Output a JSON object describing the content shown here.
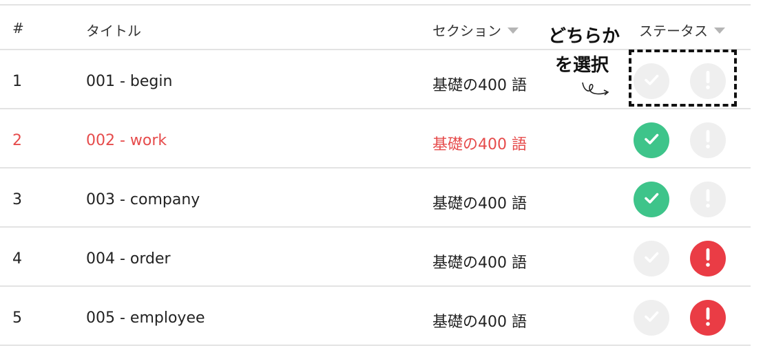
{
  "table": {
    "headers": {
      "num": "#",
      "title": "タイトル",
      "section": "セクション",
      "status": "ステータス"
    },
    "rows": [
      {
        "num": "1",
        "title": "001 - begin",
        "section": "基礎の400 語",
        "ok": false,
        "ng": false,
        "selected": false
      },
      {
        "num": "2",
        "title": "002 - work",
        "section": "基礎の400 語",
        "ok": true,
        "ng": false,
        "selected": true
      },
      {
        "num": "3",
        "title": "003 - company",
        "section": "基礎の400 語",
        "ok": true,
        "ng": false,
        "selected": false
      },
      {
        "num": "4",
        "title": "004 - order",
        "section": "基礎の400 語",
        "ok": false,
        "ng": true,
        "selected": false
      },
      {
        "num": "5",
        "title": "005 - employee",
        "section": "基礎の400 語",
        "ok": false,
        "ng": true,
        "selected": false
      }
    ]
  },
  "annotation": {
    "line1": "どちらか",
    "line2": "を選択"
  },
  "colors": {
    "ok_active": "#3ec48a",
    "ng_active": "#ea3c45",
    "inactive": "#efefef",
    "selected_text": "#e64b4b"
  },
  "icons": {
    "ok": "check-icon",
    "ng": "exclamation-icon",
    "sort": "sort-caret-icon",
    "arrow": "curly-arrow-icon"
  }
}
